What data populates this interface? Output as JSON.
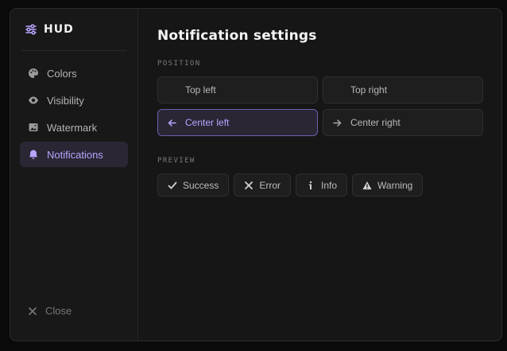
{
  "brand": {
    "name": "HUD",
    "icon": "sliders-icon"
  },
  "sidebar": {
    "items": [
      {
        "label": "Colors",
        "icon": "palette-icon",
        "active": false
      },
      {
        "label": "Visibility",
        "icon": "eye-icon",
        "active": false
      },
      {
        "label": "Watermark",
        "icon": "image-icon",
        "active": false
      },
      {
        "label": "Notifications",
        "icon": "bell-icon",
        "active": true
      }
    ],
    "close_label": "Close"
  },
  "main": {
    "title": "Notification settings",
    "position_label": "POSITION",
    "positions": [
      {
        "label": "Top left",
        "selected": false
      },
      {
        "label": "Top right",
        "selected": false
      },
      {
        "label": "Center left",
        "selected": true,
        "icon": "arrow-left-icon"
      },
      {
        "label": "Center right",
        "selected": false,
        "icon": "arrow-right-icon"
      }
    ],
    "preview_label": "PREVIEW",
    "previews": [
      {
        "label": "Success",
        "icon": "check-icon"
      },
      {
        "label": "Error",
        "icon": "x-icon"
      },
      {
        "label": "Info",
        "icon": "info-icon"
      },
      {
        "label": "Warning",
        "icon": "warning-icon"
      }
    ]
  },
  "colors": {
    "accent": "#b9a4ff",
    "active_bg": "#2a2634",
    "panel": "#161616"
  }
}
